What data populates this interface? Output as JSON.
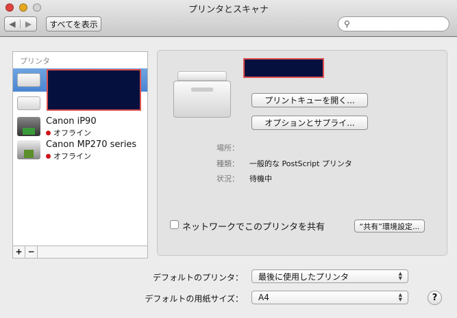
{
  "window": {
    "title": "プリンタとスキャナ"
  },
  "toolbar": {
    "show_all": "すべてを表示",
    "search_placeholder": ""
  },
  "sidebar": {
    "header": "プリンタ",
    "printers": [
      {
        "name": "",
        "status": "",
        "status_color": "#3cb043",
        "selected": true
      },
      {
        "name": "",
        "status": "",
        "status_color": "#3cb043",
        "selected": false
      },
      {
        "name": "Canon iP90",
        "status": "オフライン",
        "status_color": "#d0141a"
      },
      {
        "name": "Canon MP270 series",
        "status": "オフライン",
        "status_color": "#d0141a"
      }
    ],
    "add": "+",
    "remove": "−"
  },
  "detail": {
    "open_queue": "プリントキューを開く...",
    "options_supplies": "オプションとサプライ...",
    "location_label": "場所：",
    "location_value": "",
    "kind_label": "種類：",
    "kind_value": "一般的な PostScript プリンタ",
    "status_label": "状況：",
    "status_value": "待機中",
    "share_checkbox": "ネットワークでこのプリンタを共有",
    "share_checked": false,
    "sharing_prefs": "“共有”環境設定..."
  },
  "bottom": {
    "default_printer_label": "デフォルトのプリンタ：",
    "default_printer_value": "最後に使用したプリンタ",
    "paper_size_label": "デフォルトの用紙サイズ：",
    "paper_size_value": "A4",
    "help": "?"
  }
}
